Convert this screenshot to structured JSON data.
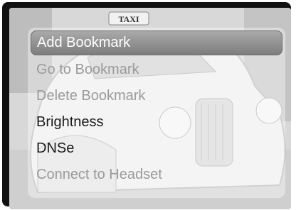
{
  "background": {
    "image": "taxi-photo",
    "sign_text": "TAXI"
  },
  "menu": {
    "items": [
      {
        "label": "Add Bookmark",
        "state": "selected"
      },
      {
        "label": "Go to Bookmark",
        "state": "disabled"
      },
      {
        "label": "Delete Bookmark",
        "state": "disabled"
      },
      {
        "label": "Brightness",
        "state": "enabled"
      },
      {
        "label": "DNSe",
        "state": "enabled"
      },
      {
        "label": "Connect to Headset",
        "state": "disabled"
      }
    ]
  },
  "colors": {
    "selected_bg": "#8c8c8c",
    "enabled_text": "#1a1a1a",
    "disabled_text": "#9a9a9a",
    "frame": "#111111"
  }
}
